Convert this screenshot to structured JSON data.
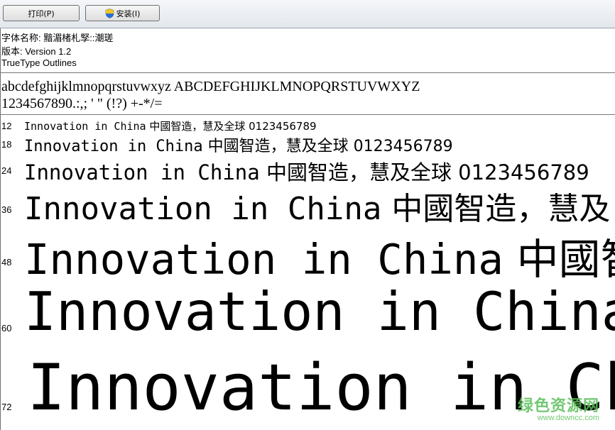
{
  "toolbar": {
    "print_label": "打印(P)",
    "install_label": "安装(I)"
  },
  "info": {
    "font_name": "字体名称: 黯湄楮札孯::潮瑳",
    "version": "版本: Version 1.2",
    "outline": "TrueType Outlines"
  },
  "charset": {
    "line1": "abcdefghijklmnopqrstuvwxyz ABCDEFGHIJKLMNOPQRSTUVWXYZ",
    "line2": "1234567890.:,; ' \" (!?) +-*/="
  },
  "samples": [
    {
      "size": "12",
      "latin": "Innovation in China",
      "cjk": " 中國智造，慧及全球 0123456789"
    },
    {
      "size": "18",
      "latin": "Innovation in China",
      "cjk": " 中國智造，慧及全球 0123456789"
    },
    {
      "size": "24",
      "latin": "Innovation in China",
      "cjk": " 中國智造，慧及全球 0123456789"
    },
    {
      "size": "36",
      "latin": "Innovation in China",
      "cjk": " 中國智造，慧及"
    },
    {
      "size": "48",
      "latin": "Innovation in China",
      "cjk": " 中國智"
    },
    {
      "size": "60",
      "latin": "Innovation in China",
      "cjk": ""
    },
    {
      "size": "72",
      "latin": "Innovation in Ch",
      "cjk": ""
    }
  ],
  "watermark": {
    "text": "绿色资源网",
    "url": "www.downcc.com"
  }
}
